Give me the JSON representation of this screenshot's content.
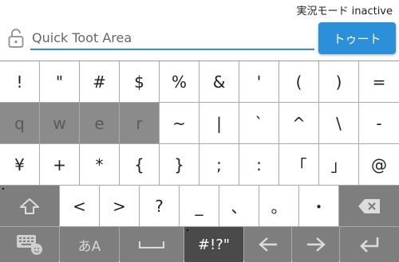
{
  "status": {
    "text": "実況モード inactive"
  },
  "compose": {
    "placeholder": "Quick Toot Area",
    "value": "",
    "toot_label": "トゥート"
  },
  "keyboard": {
    "row1": [
      "!",
      "\"",
      "#",
      "$",
      "%",
      "&",
      "'",
      "(",
      ")",
      "="
    ],
    "row2": [
      "q",
      "w",
      "e",
      "r",
      "~",
      "|",
      "`",
      "^",
      "\\",
      "-"
    ],
    "row3": [
      "¥",
      "+",
      "*",
      "{",
      "}",
      ";",
      ":",
      "「",
      "」",
      "@"
    ],
    "row4": [
      "<",
      ">",
      "?",
      "_",
      "、",
      "。",
      "・"
    ],
    "row5": {
      "kana_label": "あA",
      "symbols_label": "#!?\""
    },
    "icons": {
      "shift": "shift-arrow-icon",
      "backspace": "backspace-icon",
      "emoji_keyboard": "keyboard-emoji-icon",
      "space": "space-icon",
      "left": "arrow-left-icon",
      "right": "arrow-right-icon",
      "enter": "enter-icon",
      "lock": "lock-open-icon"
    }
  },
  "colors": {
    "accent": "#2b90d9",
    "key": "#ffffff",
    "key_disabled": "#8b8b8b",
    "function_key": "#7e7e7e",
    "active_key": "#4a4a4a"
  }
}
